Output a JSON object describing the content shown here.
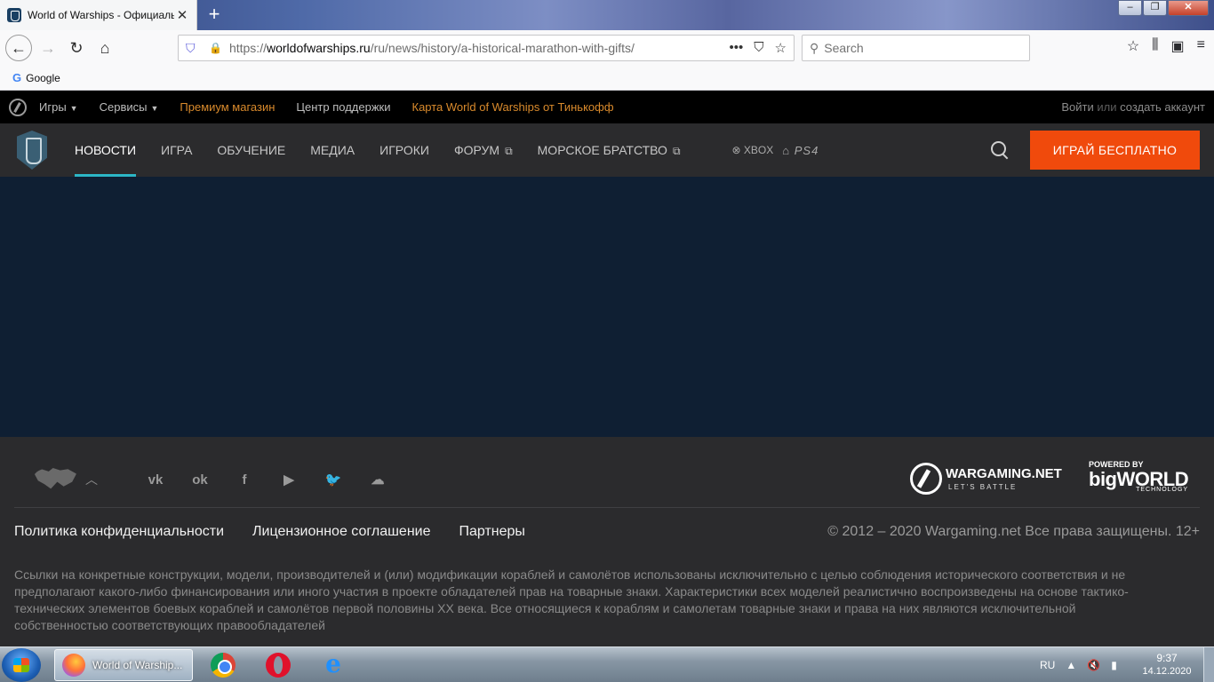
{
  "browser": {
    "tab_title": "World of Warships - Официаль",
    "url_prefix": "https://",
    "url_domain": "worldofwarships.ru",
    "url_path": "/ru/news/history/a-historical-marathon-with-gifts/",
    "search_placeholder": "Search",
    "bookmark_google": "Google"
  },
  "topbar": {
    "items": [
      "Игры",
      "Сервисы",
      "Премиум магазин",
      "Центр поддержки",
      "Карта World of Warships от Тинькофф"
    ],
    "login": "Войти",
    "or": "или",
    "register": "создать аккаунт"
  },
  "mainnav": {
    "items": [
      "НОВОСТИ",
      "ИГРА",
      "ОБУЧЕНИЕ",
      "МЕДИА",
      "ИГРОКИ",
      "ФОРУМ",
      "МОРСКОЕ БРАТСТВО"
    ],
    "xbox": "XBOX",
    "ps4": "PS4",
    "play_button": "ИГРАЙ БЕСПЛАТНО",
    "accent_color": "#2cb6c6",
    "button_color": "#f04a0c"
  },
  "footer": {
    "wargaming": "WARGAMING.NET",
    "wargaming_sub": "LET'S BATTLE",
    "powered_by": "POWERED BY",
    "bigworld": "bigWORLD",
    "technology": "TECHNOLOGY",
    "links": [
      "Политика конфиденциальности",
      "Лицензионное соглашение",
      "Партнеры"
    ],
    "copyright": "© 2012 – 2020 Wargaming.net Все права защищены. 12+",
    "disclaimer": "Ссылки на конкретные конструкции, модели, производителей и (или) модификации кораблей и самолётов использованы исключительно с целью соблюдения исторического соответствия и не предполагают какого-либо финансирования или иного участия в проекте обладателей прав на товарные знаки. Характеристики всех моделей реалистично воспроизведены на основе тактико-технических элементов боевых кораблей и самолётов первой половины XX века. Все относящиеся к кораблям и самолетам товарные знаки и права на них являются исключительной собственностью соответствующих правообладателей"
  },
  "taskbar": {
    "firefox_label": "World of Warship...",
    "lang": "RU",
    "time": "9:37",
    "date": "14.12.2020"
  }
}
